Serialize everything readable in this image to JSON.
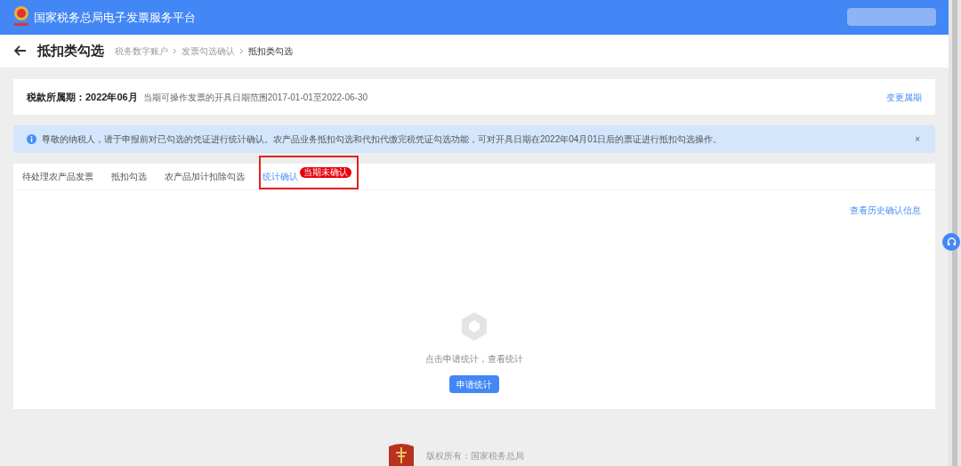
{
  "header": {
    "title": "国家税务总局电子发票服务平台"
  },
  "page": {
    "title": "抵扣类勾选",
    "breadcrumb": [
      "税务数字账户",
      "发票勾选确认",
      "抵扣类勾选"
    ]
  },
  "period": {
    "label": "税款所属期：2022年06月",
    "range": "当期可操作发票的开具日期范围2017-01-01至2022-06-30",
    "action": "变更属期"
  },
  "notice": {
    "text": "尊敬的纳税人，请于申报前对已勾选的凭证进行统计确认。农产品业务抵扣勾选和代扣代缴完税凭证勾选功能，可对开具日期在2022年04月01日后的票证进行抵扣勾选操作。",
    "close": "×"
  },
  "tabs": [
    {
      "label": "待处理农产品发票",
      "selected": false
    },
    {
      "label": "抵扣勾选",
      "selected": false
    },
    {
      "label": "农产品加计扣除勾选",
      "selected": false
    },
    {
      "label": "统计确认",
      "selected": true,
      "badge": "当期未确认",
      "highlighted": true
    }
  ],
  "history_link": "查看历史确认信息",
  "empty": {
    "message": "点击申请统计，查看统计",
    "button": "申请统计"
  },
  "footer": {
    "copyright": "版权所有：国家税务总局"
  }
}
